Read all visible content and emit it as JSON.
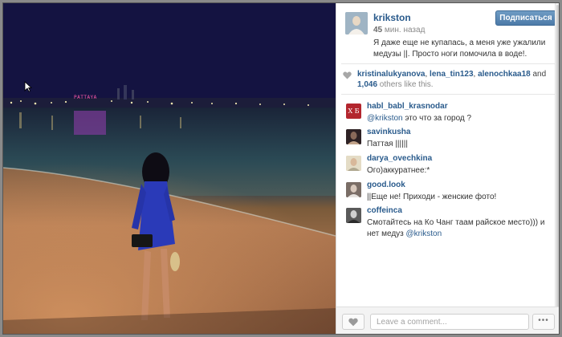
{
  "post": {
    "username": "krikston",
    "time_value": "45",
    "time_unit": "мин. назад",
    "follow_label": "Подписаться",
    "caption": "Я даже еще не купапась, а меня уже ужалили медузы ||. Просто ноги помочила в воде!."
  },
  "photo": {
    "sign_text": "PATTAYA"
  },
  "likes": {
    "users": [
      "kristinalukyanova",
      "lena_tin123",
      "alenochkaa18"
    ],
    "sep1": ", ",
    "sep2": ", ",
    "and": " and",
    "count": "1,046",
    "suffix": " others like this."
  },
  "comments": [
    {
      "user": "habl_babl_krasnodar",
      "mention": "@krikston",
      "text": " это что за город ?",
      "avatar": "text-avatar",
      "avatar_letters": "Х Б",
      "avatar_color": "#b3262e"
    },
    {
      "user": "savinkusha",
      "mention": "",
      "text": "Паттая ||||||",
      "avatar": "photo-avatar",
      "avatar_color": "#3a2b2e"
    },
    {
      "user": "darya_ovechkina",
      "mention": "",
      "text": "Ого)аккуратнее:*",
      "avatar": "photo-avatar",
      "avatar_color": "#d8c7a0"
    },
    {
      "user": "good.look",
      "mention": "",
      "text": "||Еще не! Приходи - женские фото!",
      "avatar": "photo-avatar",
      "avatar_color": "#8a7b72"
    },
    {
      "user": "coffeinca",
      "mention": "",
      "text": "Смотайтесь на Ко Чанг таам райское место))) и нет медуз ",
      "mention_after": "@krikston",
      "avatar": "photo-avatar",
      "avatar_color": "#6b6b6b"
    }
  ],
  "footer": {
    "placeholder": "Leave a comment...",
    "more_label": "•••"
  },
  "colors": {
    "link": "#2a5b8c",
    "button": "#4c7aa8"
  }
}
